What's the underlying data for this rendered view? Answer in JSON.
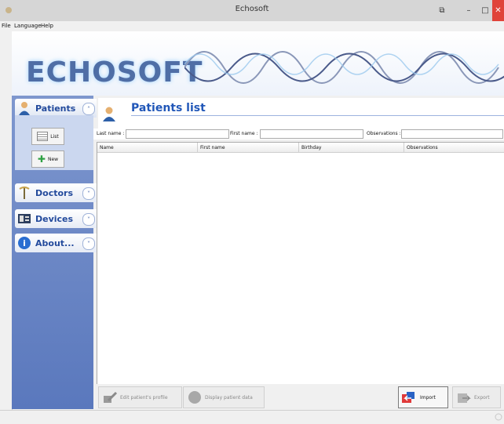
{
  "window": {
    "title": "Echosoft",
    "min_glyph": "–",
    "max_glyph": "□",
    "close_glyph": "✕",
    "restore_glyph": "⧉"
  },
  "menu": [
    "File",
    "Language",
    "Help"
  ],
  "banner": {
    "logo": "ECHOSOFT"
  },
  "sidebar": {
    "sections": [
      {
        "label": "Patients",
        "icon": "person-icon",
        "expanded": true
      },
      {
        "label": "Doctors",
        "icon": "caduceus-icon",
        "expanded": false
      },
      {
        "label": "Devices",
        "icon": "device-icon",
        "expanded": false
      },
      {
        "label": "About...",
        "icon": "info-icon",
        "expanded": false
      }
    ],
    "patients_buttons": [
      {
        "label": "List",
        "icon": "list-icon"
      },
      {
        "label": "New",
        "icon": "plus-icon"
      }
    ]
  },
  "main": {
    "title": "Patients list",
    "filters": {
      "last_name": "Last name :",
      "first_name": "First name :",
      "observations": "Observations :"
    },
    "columns": [
      "Name",
      "First name",
      "Birthday",
      "Observations"
    ],
    "rows": []
  },
  "actions": {
    "edit": "Edit patient's profile",
    "display": "Display patient data",
    "import": "Import",
    "export": "Export"
  },
  "colors": {
    "accent": "#2157b8",
    "sidebar": "#6a86c6",
    "close": "#e0443a"
  }
}
